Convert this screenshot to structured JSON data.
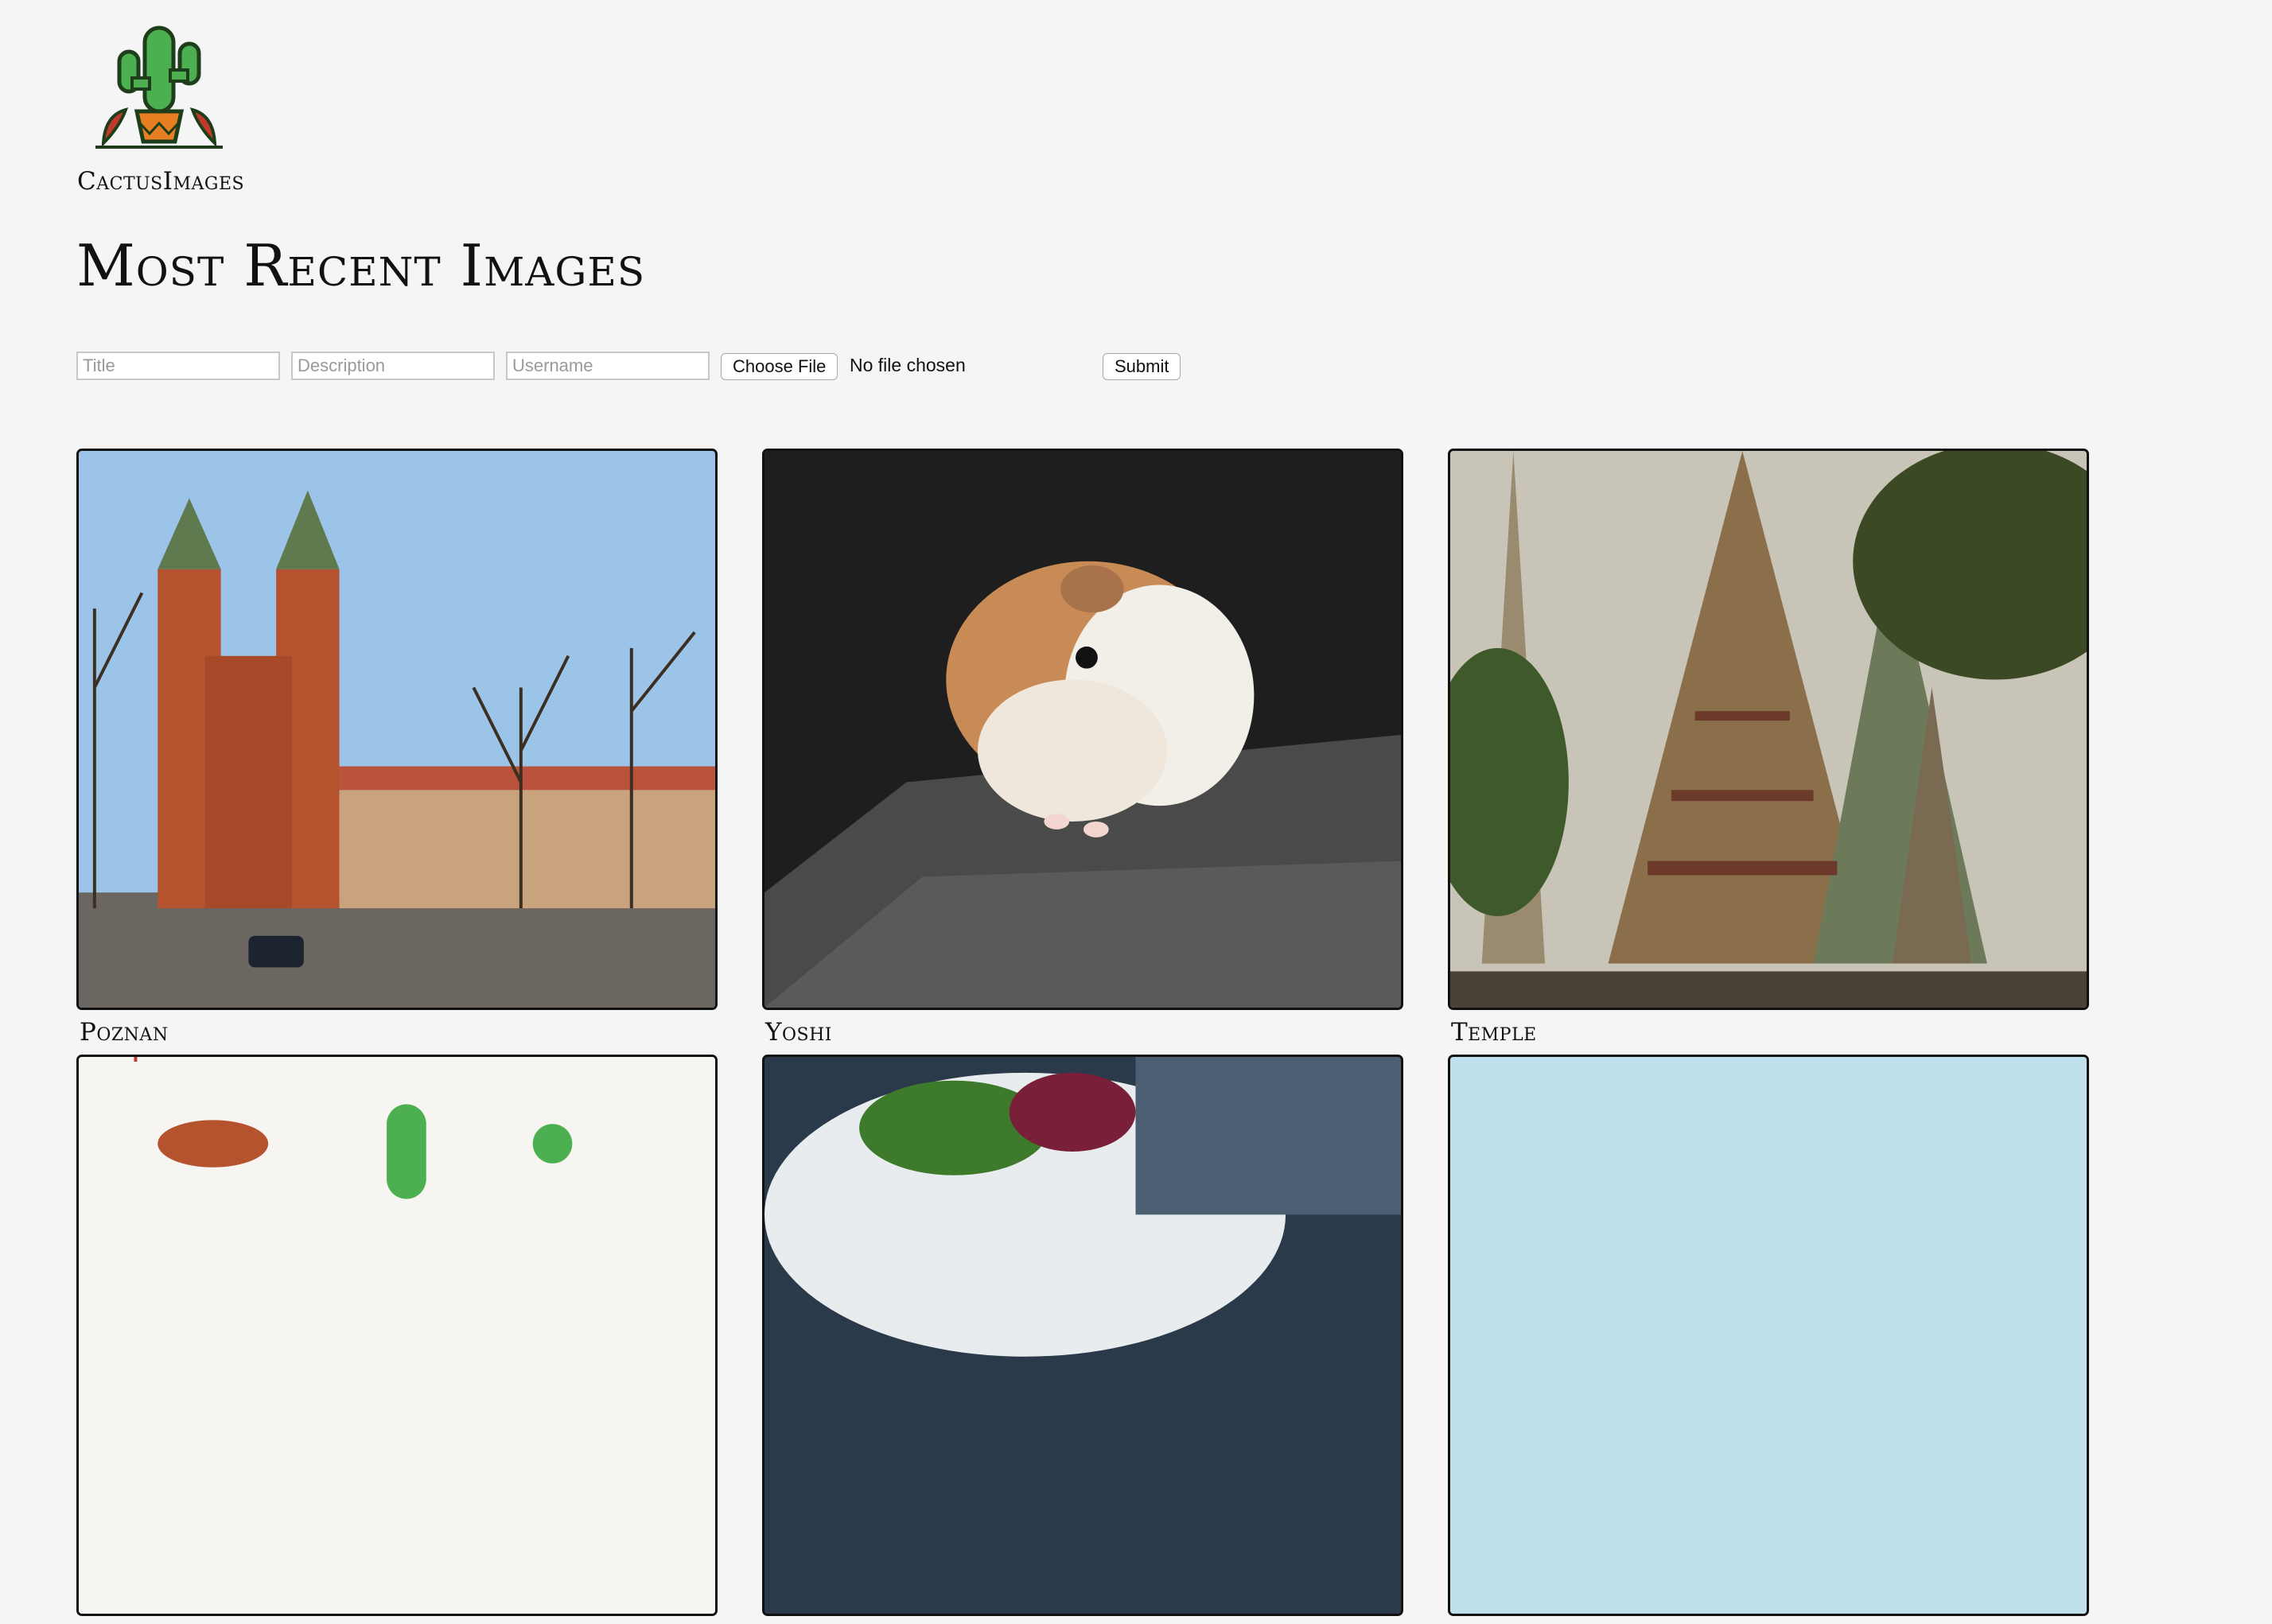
{
  "brand": {
    "name": "CactusImages"
  },
  "page": {
    "title": "Most Recent Images"
  },
  "form": {
    "title_placeholder": "Title",
    "description_placeholder": "Description",
    "username_placeholder": "Username",
    "choose_file_label": "Choose File",
    "file_status": "No file chosen",
    "submit_label": "Submit"
  },
  "images": [
    {
      "title": "Poznan"
    },
    {
      "title": "Yoshi"
    },
    {
      "title": "Temple"
    },
    {
      "title": ""
    },
    {
      "title": ""
    },
    {
      "title": ""
    }
  ],
  "colors": {
    "background": "#f5f5f5",
    "cactus_green": "#4caf50",
    "pepper_red": "#c0392b",
    "frame": "#111111"
  }
}
